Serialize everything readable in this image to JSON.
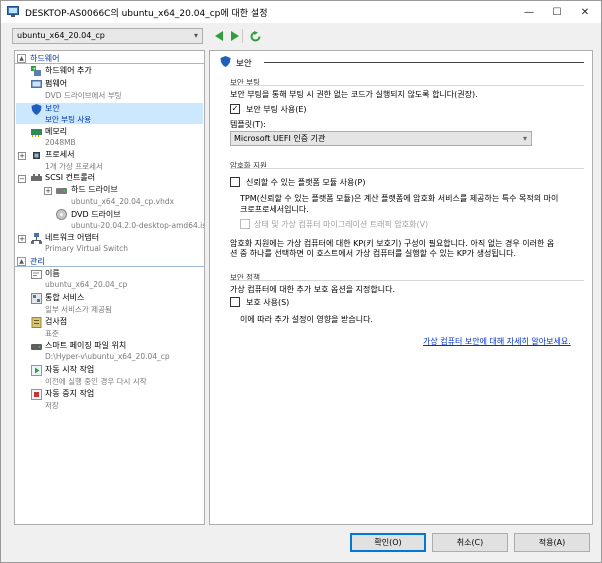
{
  "window": {
    "title": "DESKTOP-AS0066C의 ubuntu_x64_20.04_cp에 대한 설정",
    "minimize": "—",
    "maximize": "☐",
    "close": "✕"
  },
  "toolbar": {
    "vm_name": "ubuntu_x64_20.04_cp"
  },
  "tree": {
    "hardware_header": "하드웨어",
    "hardware": [
      {
        "label": "하드웨어 추가",
        "sub": ""
      },
      {
        "label": "펌웨어",
        "sub": "DVD 드라이브에서 부팅"
      },
      {
        "label": "보안",
        "sub": "보안 부팅 사용"
      },
      {
        "label": "메모리",
        "sub": "2048MB"
      },
      {
        "label": "프로세서",
        "sub": "1개 가상 프로세서"
      },
      {
        "label": "SCSI 컨트롤러",
        "sub": ""
      },
      {
        "label": "하드 드라이브",
        "sub": "ubuntu_x64_20.04_cp.vhdx"
      },
      {
        "label": "DVD 드라이브",
        "sub": "ubuntu-20.04.2.0-desktop-amd64.iso"
      },
      {
        "label": "네트워크 어댑터",
        "sub": "Primary Virtual Switch"
      }
    ],
    "management_header": "관리",
    "management": [
      {
        "label": "이름",
        "sub": "ubuntu_x64_20.04_cp"
      },
      {
        "label": "통합 서비스",
        "sub": "일부 서비스가 제공됨"
      },
      {
        "label": "검사점",
        "sub": "표준"
      },
      {
        "label": "스마트 페이징 파일 위치",
        "sub": "D:\\Hyper-v\\ubuntu_x64_20.04_cp"
      },
      {
        "label": "자동 시작 작업",
        "sub": "이전에 실행 중인 경우 다시 시작"
      },
      {
        "label": "자동 중지 작업",
        "sub": "저장"
      }
    ]
  },
  "panel": {
    "header": "보안",
    "secure_boot": {
      "title": "보안 부팅",
      "desc": "보안 부팅을 통해 부팅 시 권한 없는 코드가 실행되지 않도록 합니다(권장).",
      "enable_label": "보안 부팅 사용(E)",
      "enabled": true,
      "template_label": "템플릿(T):",
      "template_value": "Microsoft UEFI 인증 기관"
    },
    "encryption": {
      "title": "암호화 지원",
      "tpm_label": "신뢰할 수 있는 플랫폼 모듈 사용(P)",
      "tpm_desc_1": "TPM(신뢰할 수 있는 플랫폼 모듈)은 계산 플랫폼에 암호화 서비스를 제공하는 특수 목적의 마이",
      "tpm_desc_2": "크로프로세서입니다.",
      "traffic_label": "상태 및 가상 컴퓨터 마이그레이션 트래픽 암호화(V)",
      "kp_desc_1": "암호화 지원에는 가상 컴퓨터에 대한 KP(키 보호기) 구성이 필요합니다. 아직 없는 경우 이러한 옵",
      "kp_desc_2": "션 중 하나를 선택하면 이 호스트에서 가상 컴퓨터를 실행할 수 있는 KP가 생성됩니다."
    },
    "policy": {
      "title": "보안 정책",
      "desc": "가상 컴퓨터에 대한 추가 보호 옵션을 지정합니다.",
      "shield_label": "보호 사용(S)",
      "shield_desc": "이에 따라 추가 설정이 영향을 받습니다."
    },
    "learn_more": "가상 컴퓨터 보안에 대해 자세히 알아보세요."
  },
  "buttons": {
    "ok": "확인(O)",
    "cancel": "취소(C)",
    "apply": "적용(A)"
  }
}
